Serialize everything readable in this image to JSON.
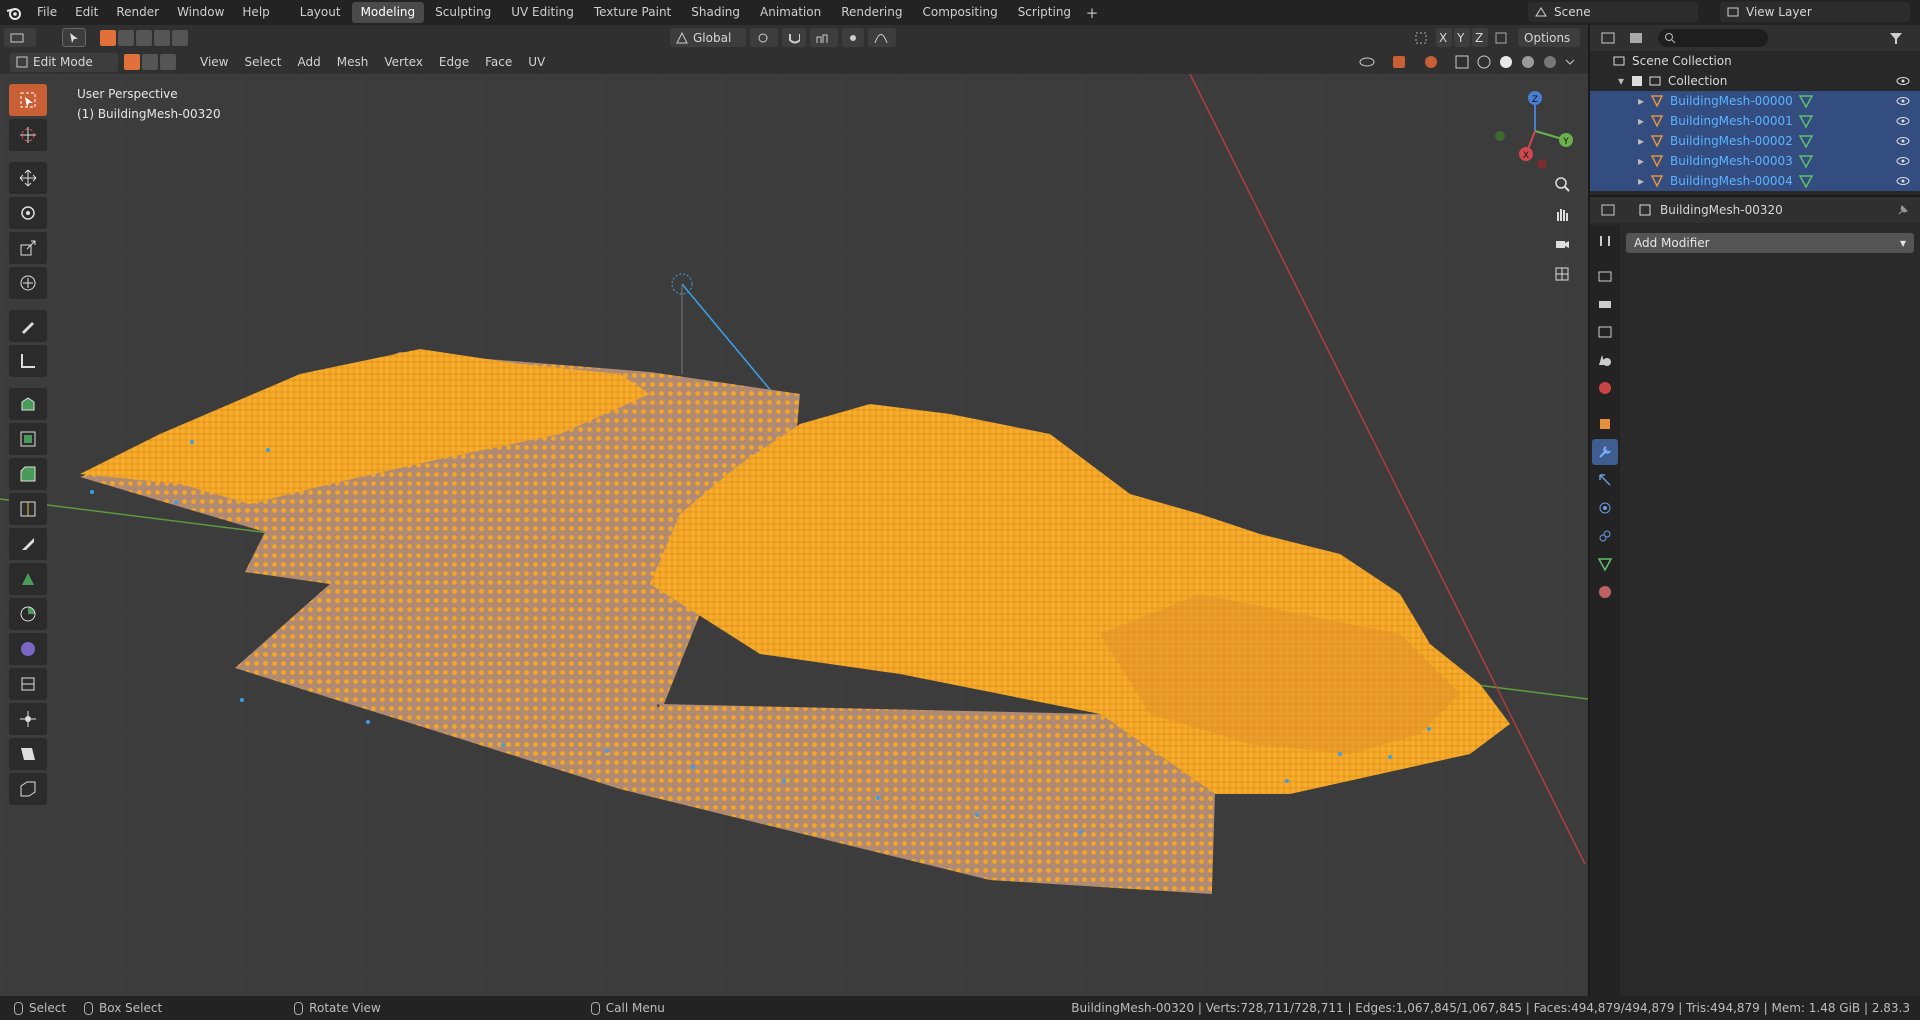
{
  "menu": {
    "items": [
      "File",
      "Edit",
      "Render",
      "Window",
      "Help"
    ]
  },
  "workspaces": {
    "tabs": [
      "Layout",
      "Modeling",
      "Sculpting",
      "UV Editing",
      "Texture Paint",
      "Shading",
      "Animation",
      "Rendering",
      "Compositing",
      "Scripting"
    ],
    "active": "Modeling"
  },
  "scene": {
    "name": "Scene"
  },
  "view_layer": {
    "name": "View Layer"
  },
  "viewport_header": {
    "transform_orientation": "Global",
    "options_label": "Options",
    "axes": [
      "X",
      "Y",
      "Z"
    ],
    "mode": "Edit Mode",
    "menus": [
      "View",
      "Select",
      "Add",
      "Mesh",
      "Vertex",
      "Edge",
      "Face",
      "UV"
    ]
  },
  "viewport": {
    "view_name": "User Perspective",
    "object_info": "(1) BuildingMesh-00320",
    "gizmo_axes": {
      "x": "X",
      "y": "Y",
      "z": "Z"
    },
    "colors": {
      "mesh_vertex": "#f5a623",
      "mesh_face": "#b08a72",
      "grid_bg": "#3c3c3c",
      "x_axis": "#b5393c",
      "y_axis": "#5c9a3d"
    }
  },
  "outliner": {
    "root": "Scene Collection",
    "collection": "Collection",
    "objects": [
      "BuildingMesh-00000",
      "BuildingMesh-00001",
      "BuildingMesh-00002",
      "BuildingMesh-00003",
      "BuildingMesh-00004"
    ]
  },
  "properties": {
    "object_name": "BuildingMesh-00320",
    "add_modifier_label": "Add Modifier"
  },
  "statusbar": {
    "select": "Select",
    "box_select": "Box Select",
    "rotate_view": "Rotate View",
    "call_menu": "Call Menu",
    "stats": "BuildingMesh-00320 | Verts:728,711/728,711 | Edges:1,067,845/1,067,845 | Faces:494,879/494,879 | Tris:494,879 | Mem: 1.48 GiB | 2.83.3"
  }
}
